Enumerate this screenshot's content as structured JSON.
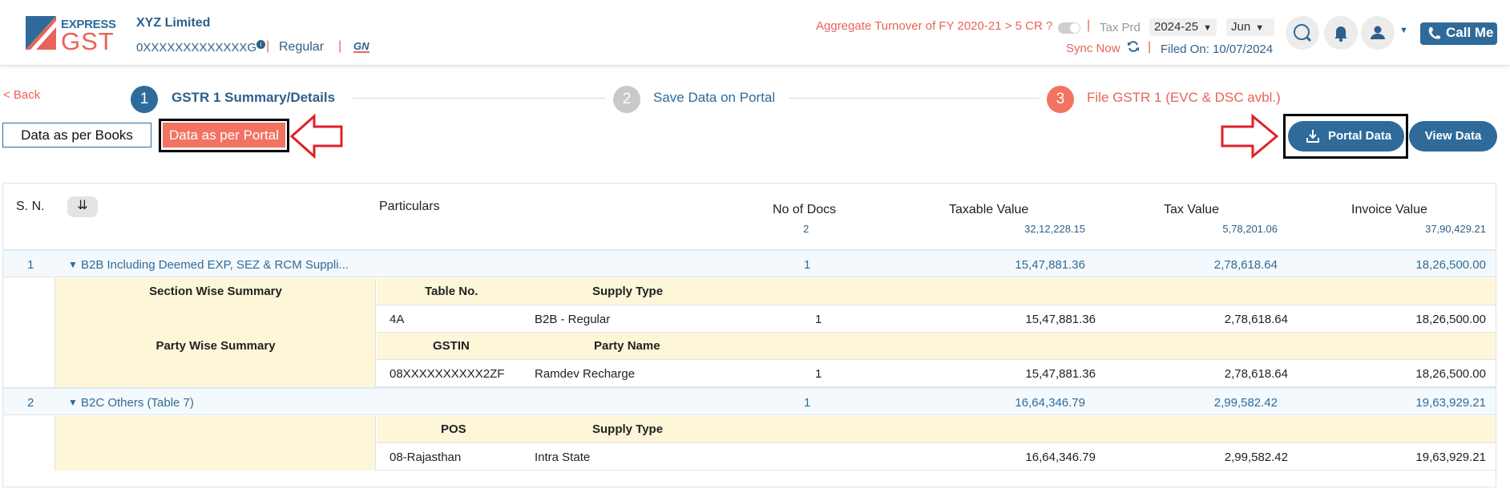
{
  "header": {
    "brand_top": "EXPRESS",
    "brand_bottom": "GST",
    "company_name": "XYZ Limited",
    "gstin": "0XXXXXXXXXXXXXG",
    "gstin_info_badge": "i",
    "separator": "|",
    "registration_type": "Regular",
    "gn_icon_text": "GN",
    "aggregate_turnover": "Aggregate Turnover of FY 2020-21 > 5 CR ?",
    "tax_period_label": "Tax Prd",
    "year_select": "2024-25",
    "month_select": "Jun",
    "sync_now": "Sync Now",
    "filed_on": "Filed On: 10/07/2024",
    "call_me": "Call Me"
  },
  "stepper": {
    "back": "< Back",
    "steps": [
      {
        "num": "1",
        "label": "GSTR 1 Summary/Details"
      },
      {
        "num": "2",
        "label": "Save Data on Portal"
      },
      {
        "num": "3",
        "label": "File GSTR 1 (EVC & DSC avbl.)"
      }
    ]
  },
  "toolbar": {
    "data_books": "Data as per Books",
    "data_portal": "Data as per Portal",
    "portal_data": "Portal Data",
    "view_data": "View Data"
  },
  "table": {
    "headers": {
      "sn": "S. N.",
      "particulars": "Particulars",
      "no_of_docs": "No of Docs",
      "taxable_value": "Taxable Value",
      "tax_value": "Tax Value",
      "invoice_value": "Invoice Value"
    },
    "totals": {
      "no_of_docs": "2",
      "taxable_value": "32,12,228.15",
      "tax_value": "5,78,201.06",
      "invoice_value": "37,90,429.21"
    },
    "rows": [
      {
        "sn": "1",
        "particular": "B2B Including Deemed EXP, SEZ & RCM Suppli...",
        "docs": "1",
        "taxable": "15,47,881.36",
        "tax": "2,78,618.64",
        "invoice": "18,26,500.00",
        "sections": [
          {
            "label": "Section Wise Summary",
            "col1_head": "Table No.",
            "col2_head": "Supply Type",
            "col1": "4A",
            "col2": "B2B - Regular",
            "docs": "1",
            "taxable": "15,47,881.36",
            "tax": "2,78,618.64",
            "invoice": "18,26,500.00"
          },
          {
            "label": "Party Wise Summary",
            "col1_head": "GSTIN",
            "col2_head": "Party Name",
            "col1": "08XXXXXXXXXX2ZF",
            "col2": "Ramdev Recharge",
            "docs": "1",
            "taxable": "15,47,881.36",
            "tax": "2,78,618.64",
            "invoice": "18,26,500.00"
          }
        ]
      },
      {
        "sn": "2",
        "particular": "B2C Others (Table 7)",
        "docs": "1",
        "taxable": "16,64,346.79",
        "tax": "2,99,582.42",
        "invoice": "19,63,929.21",
        "sections": [
          {
            "label": "",
            "col1_head": "POS",
            "col2_head": "Supply Type",
            "col1": "08-Rajasthan",
            "col2": "Intra State",
            "docs": "",
            "taxable": "16,64,346.79",
            "tax": "2,99,582.42",
            "invoice": "19,63,929.21"
          }
        ]
      }
    ]
  },
  "colors": {
    "primary_blue": "#2f6b9a",
    "accent_salmon": "#f27362",
    "subrow_yellow": "#fdf6d9",
    "annotation_red": "#e0202a"
  }
}
